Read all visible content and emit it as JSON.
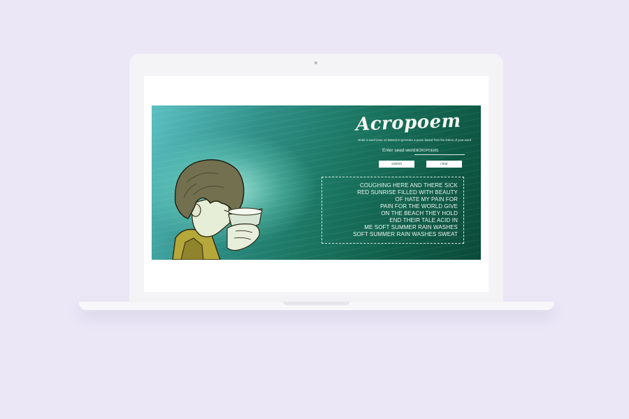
{
  "app": {
    "title": "Acropoem",
    "instructions": "Enter a word (max 10 letters) to generate a poem based from the letters of your word",
    "seed_label": "Enter seed word :",
    "seed_value": "ACROPOEMS",
    "submit_label": "submit",
    "clear_label": "clear"
  },
  "poem": {
    "lines": [
      "COUGHING HERE AND THERE SICK",
      "RED SUNRISE FILLED WITH BEAUTY",
      "OF HATE MY PAIN FOR",
      "PAIN FOR THE WORLD GIVE",
      "ON THE BEACH THEY HOLD",
      "END THEIR TALE ACID IN",
      "ME SOFT SUMMER RAIN WASHES",
      "SOFT SUMMER RAIN WASHES SWEAT"
    ]
  },
  "colors": {
    "page_background": "#ebe7f7",
    "hero_dark": "#0b4a39",
    "hero_light": "#5cc0c3",
    "text_light": "#eef6f0"
  },
  "icons": {
    "camera": "laptop-camera-dot"
  }
}
